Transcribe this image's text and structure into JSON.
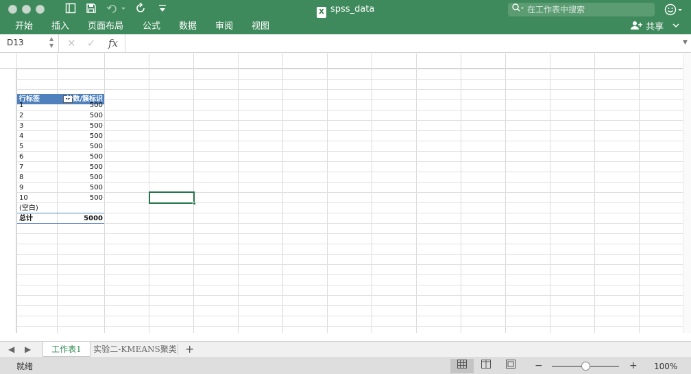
{
  "window": {
    "title": "spss_data",
    "search_placeholder": "在工作表中搜索"
  },
  "toolbar": {
    "icons": [
      "sidebar-icon",
      "save-icon",
      "undo-icon",
      "redo-icon",
      "customize-icon"
    ]
  },
  "ribbon": {
    "tabs": [
      "开始",
      "插入",
      "页面布局",
      "公式",
      "数据",
      "审阅",
      "视图"
    ],
    "share_label": "共享"
  },
  "formula_bar": {
    "name_box": "D13",
    "fx_label": "fx",
    "formula": ""
  },
  "pivot": {
    "row_label_header": "行标签",
    "value_header": "计数/簇标识",
    "rows": [
      {
        "label": "1",
        "value": "500"
      },
      {
        "label": "2",
        "value": "500"
      },
      {
        "label": "3",
        "value": "500"
      },
      {
        "label": "4",
        "value": "500"
      },
      {
        "label": "5",
        "value": "500"
      },
      {
        "label": "6",
        "value": "500"
      },
      {
        "label": "7",
        "value": "500"
      },
      {
        "label": "8",
        "value": "500"
      },
      {
        "label": "9",
        "value": "500"
      },
      {
        "label": "10",
        "value": "500"
      }
    ],
    "blank_label": "(空白)",
    "total_label": "总计",
    "total_value": "5000"
  },
  "sheets": {
    "tabs": [
      "工作表1",
      "实验二-KMEANS聚类"
    ],
    "active_index": 0,
    "add_label": "+"
  },
  "status": {
    "text": "就绪",
    "zoom": "100%",
    "zoom_minus": "−",
    "zoom_plus": "+"
  },
  "colors": {
    "title_bar": "#3f8a5c",
    "pivot_header": "#4f81bd",
    "selection": "#217346"
  }
}
